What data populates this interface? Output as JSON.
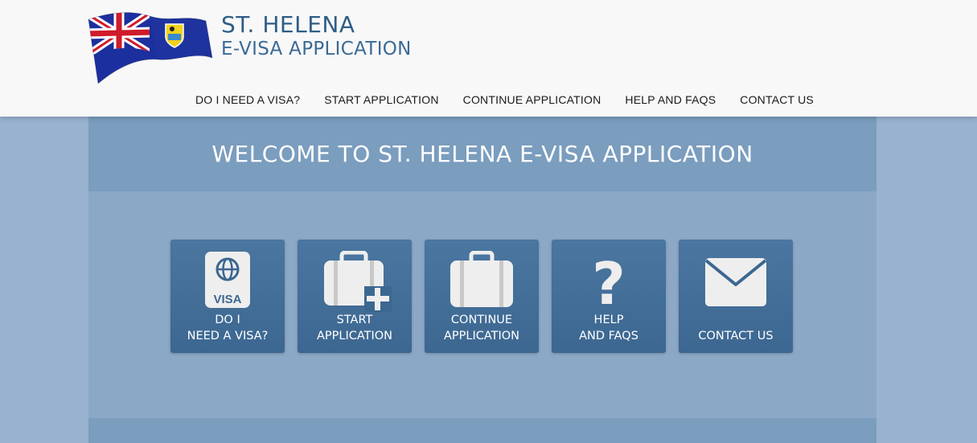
{
  "brand": {
    "title": "ST. HELENA",
    "subtitle": "E-VISA APPLICATION"
  },
  "nav": {
    "items": [
      {
        "label": "DO I NEED A VISA?"
      },
      {
        "label": "START APPLICATION"
      },
      {
        "label": "CONTINUE APPLICATION"
      },
      {
        "label": "HELP AND FAQS"
      },
      {
        "label": "CONTACT US"
      }
    ]
  },
  "welcome": {
    "title": "WELCOME TO ST. HELENA E-VISA APPLICATION"
  },
  "tiles": [
    {
      "label": "DO I\nNEED A VISA?",
      "icon": "passport-visa-icon",
      "icon_text": "VISA"
    },
    {
      "label": "START\nAPPLICATION",
      "icon": "briefcase-plus-icon"
    },
    {
      "label": "CONTINUE\nAPPLICATION",
      "icon": "briefcase-icon"
    },
    {
      "label": "HELP\nAND FAQS",
      "icon": "question-mark-icon",
      "icon_text": "?"
    },
    {
      "label": "CONTACT US",
      "icon": "envelope-icon"
    }
  ],
  "colors": {
    "header_bg": "#f8f8f8",
    "brand_blue": "#2f5d87",
    "page_bg": "#98b2cf",
    "panel_bg": "#8ba8c6",
    "tile_bg": "#44709a"
  }
}
